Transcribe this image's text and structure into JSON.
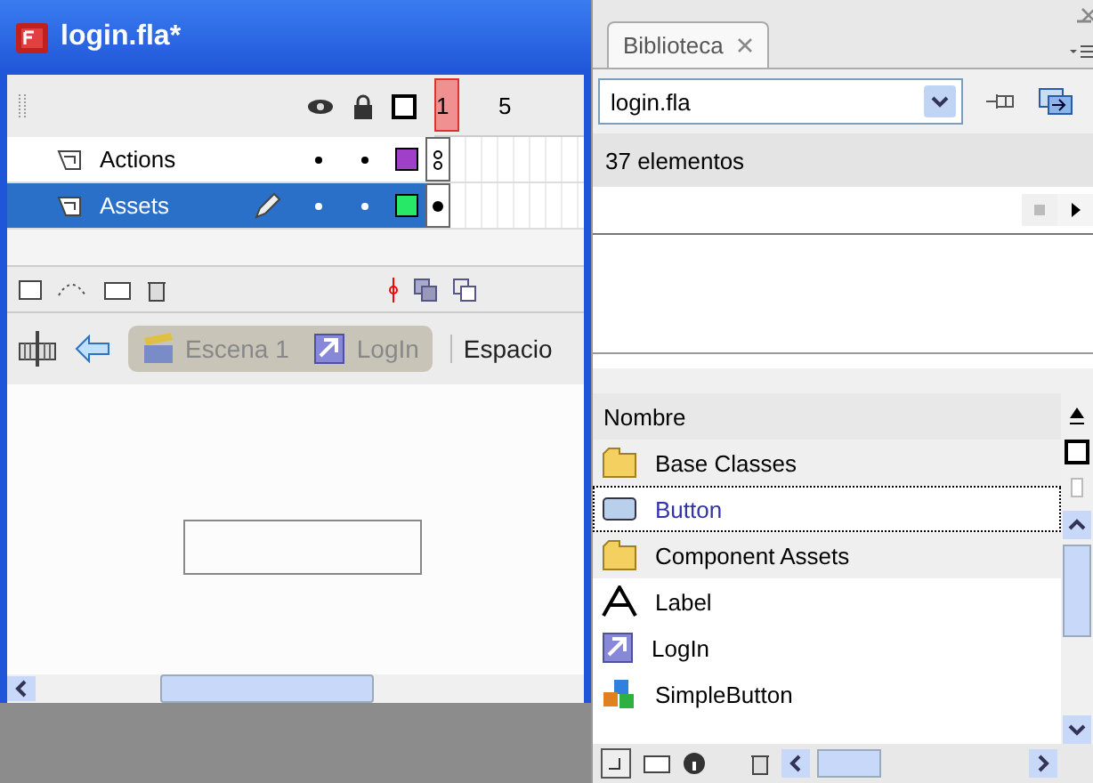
{
  "window": {
    "title": "login.fla*"
  },
  "timeline": {
    "frame_ticks": [
      "1",
      "5"
    ],
    "layers": [
      {
        "name": "Actions",
        "selected": false,
        "editing": false,
        "color": "#a040c8",
        "keyframe_filled": false
      },
      {
        "name": "Assets",
        "selected": true,
        "editing": true,
        "color": "#28e868",
        "keyframe_filled": true
      }
    ]
  },
  "breadcrumb": {
    "items": [
      {
        "label": "Escena 1",
        "kind": "scene"
      },
      {
        "label": "LogIn",
        "kind": "symbol"
      }
    ],
    "workspace": "Espacio"
  },
  "library": {
    "tab": "Biblioteca",
    "file": "login.fla",
    "count": "37 elementos",
    "column": "Nombre",
    "items": [
      {
        "name": "Base Classes",
        "kind": "folder",
        "selected": false
      },
      {
        "name": "Button",
        "kind": "button",
        "selected": true
      },
      {
        "name": "Component Assets",
        "kind": "folder",
        "selected": false
      },
      {
        "name": "Label",
        "kind": "font",
        "selected": false
      },
      {
        "name": "LogIn",
        "kind": "movieclip",
        "selected": false
      },
      {
        "name": "SimpleButton",
        "kind": "component",
        "selected": false
      }
    ]
  }
}
